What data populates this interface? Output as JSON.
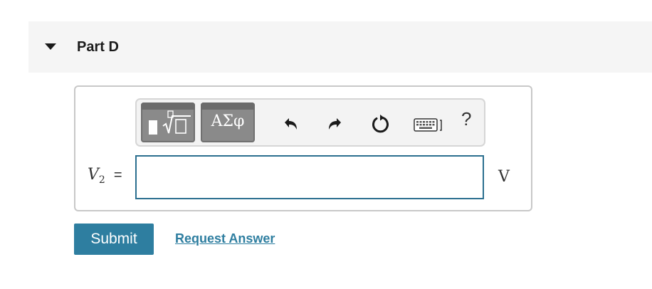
{
  "part": {
    "title": "Part D",
    "caret_icon": "caret-down-icon"
  },
  "toolbar": {
    "templates_icon": "math-templates-icon",
    "greek_label": "ΑΣφ",
    "undo_icon": "undo-icon",
    "redo_icon": "redo-icon",
    "reset_icon": "reset-icon",
    "keyboard_icon": "keyboard-icon",
    "help_label": "?"
  },
  "answer": {
    "variable": "V",
    "subscript": "2",
    "equals": "=",
    "value": "",
    "unit": "V"
  },
  "actions": {
    "submit_label": "Submit",
    "request_label": "Request Answer"
  },
  "colors": {
    "accent": "#2e7ea0",
    "header_bg": "#f5f5f5",
    "toolbar_button": "#8a8a8a"
  }
}
